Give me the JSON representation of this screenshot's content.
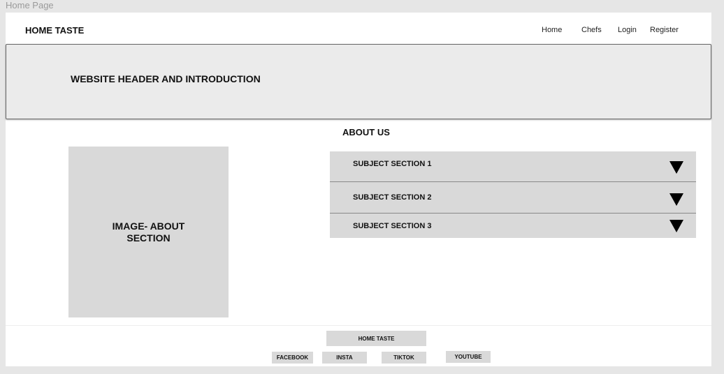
{
  "frame_title": "Home Page",
  "header": {
    "brand": "HOME TASTE",
    "nav": [
      "Home",
      "Chefs",
      "Login",
      "Register"
    ]
  },
  "hero": {
    "title": "WEBSITE HEADER AND INTRODUCTION"
  },
  "about": {
    "title": "ABOUT US",
    "image_label": "IMAGE- ABOUT SECTION",
    "sections": [
      "SUBJECT SECTION 1",
      "SUBJECT SECTION 2",
      "SUBJECT SECTION 3"
    ]
  },
  "footer": {
    "brand": "HOME TASTE",
    "social": [
      "FACEBOOK",
      "INSTA",
      "TIKTOK",
      "YOUTUBE"
    ]
  }
}
